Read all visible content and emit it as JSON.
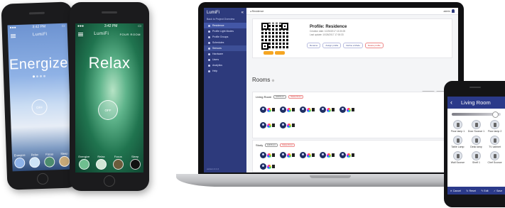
{
  "phones": {
    "energize": {
      "time": "3:42 PM",
      "brand": "LumiFi",
      "scene": "Energize",
      "power": "OFF",
      "scene_labels": [
        "Energize",
        "Relax",
        "Focus",
        "Sleep"
      ]
    },
    "relax": {
      "time": "3:42 PM",
      "brand": "LumiFi",
      "room_tag": "FOUR ROOM",
      "scene": "Relax",
      "power": "OFF",
      "scene_labels": [
        "Energize",
        "Relax",
        "Focus",
        "Sleep"
      ]
    }
  },
  "laptop": {
    "sidebar": {
      "brand": "LumiFi",
      "collapse_icon": "«",
      "back_link": "Back to Project Overview",
      "items": [
        {
          "label": "Residence",
          "active": true
        },
        {
          "label": "Profile Light Modes",
          "active": false
        },
        {
          "label": "Profile Groups",
          "active": false
        },
        {
          "label": "Schedules",
          "active": false
        },
        {
          "label": "Sensors",
          "active": false
        },
        {
          "label": "Hardware",
          "active": false
        },
        {
          "label": "Users",
          "active": false
        },
        {
          "label": "Analytics",
          "active": false
        },
        {
          "label": "Help",
          "active": false
        }
      ],
      "version": "version 2.1.0"
    },
    "topbar": {
      "crumb": "◂ Residence",
      "user": "admin"
    },
    "profile": {
      "title": "Profile: Residence",
      "created": "Creation date: 10/26/2017 13:30:25",
      "updated": "Last update: 10/26/2017 17:00:33",
      "buttons": [
        "Rename",
        "Assign profile",
        "Define a Mode",
        "Delete profile"
      ]
    },
    "rooms_title": "Rooms",
    "top_right_buttons": [
      "Add Light",
      "Add Scene Ctrl"
    ],
    "rooms": [
      {
        "name": "Living Room",
        "edit": "Edit Room",
        "delete": "Delete Room"
      },
      {
        "name": "Study",
        "edit": "Edit Room",
        "delete": "Delete Room"
      }
    ]
  },
  "mobile": {
    "back_icon": "‹",
    "title": "Living Room",
    "lamps": [
      "Floor lamp 1",
      "Door Sconce 1",
      "Floor lamp 2",
      "Table Lamp",
      "Desk lamp",
      "TV cabinet",
      "Wall Sconce",
      "Shelf 1",
      "Chef Sconce"
    ],
    "footer": [
      "Cancel",
      "Reset",
      "Edit",
      "Save"
    ]
  }
}
